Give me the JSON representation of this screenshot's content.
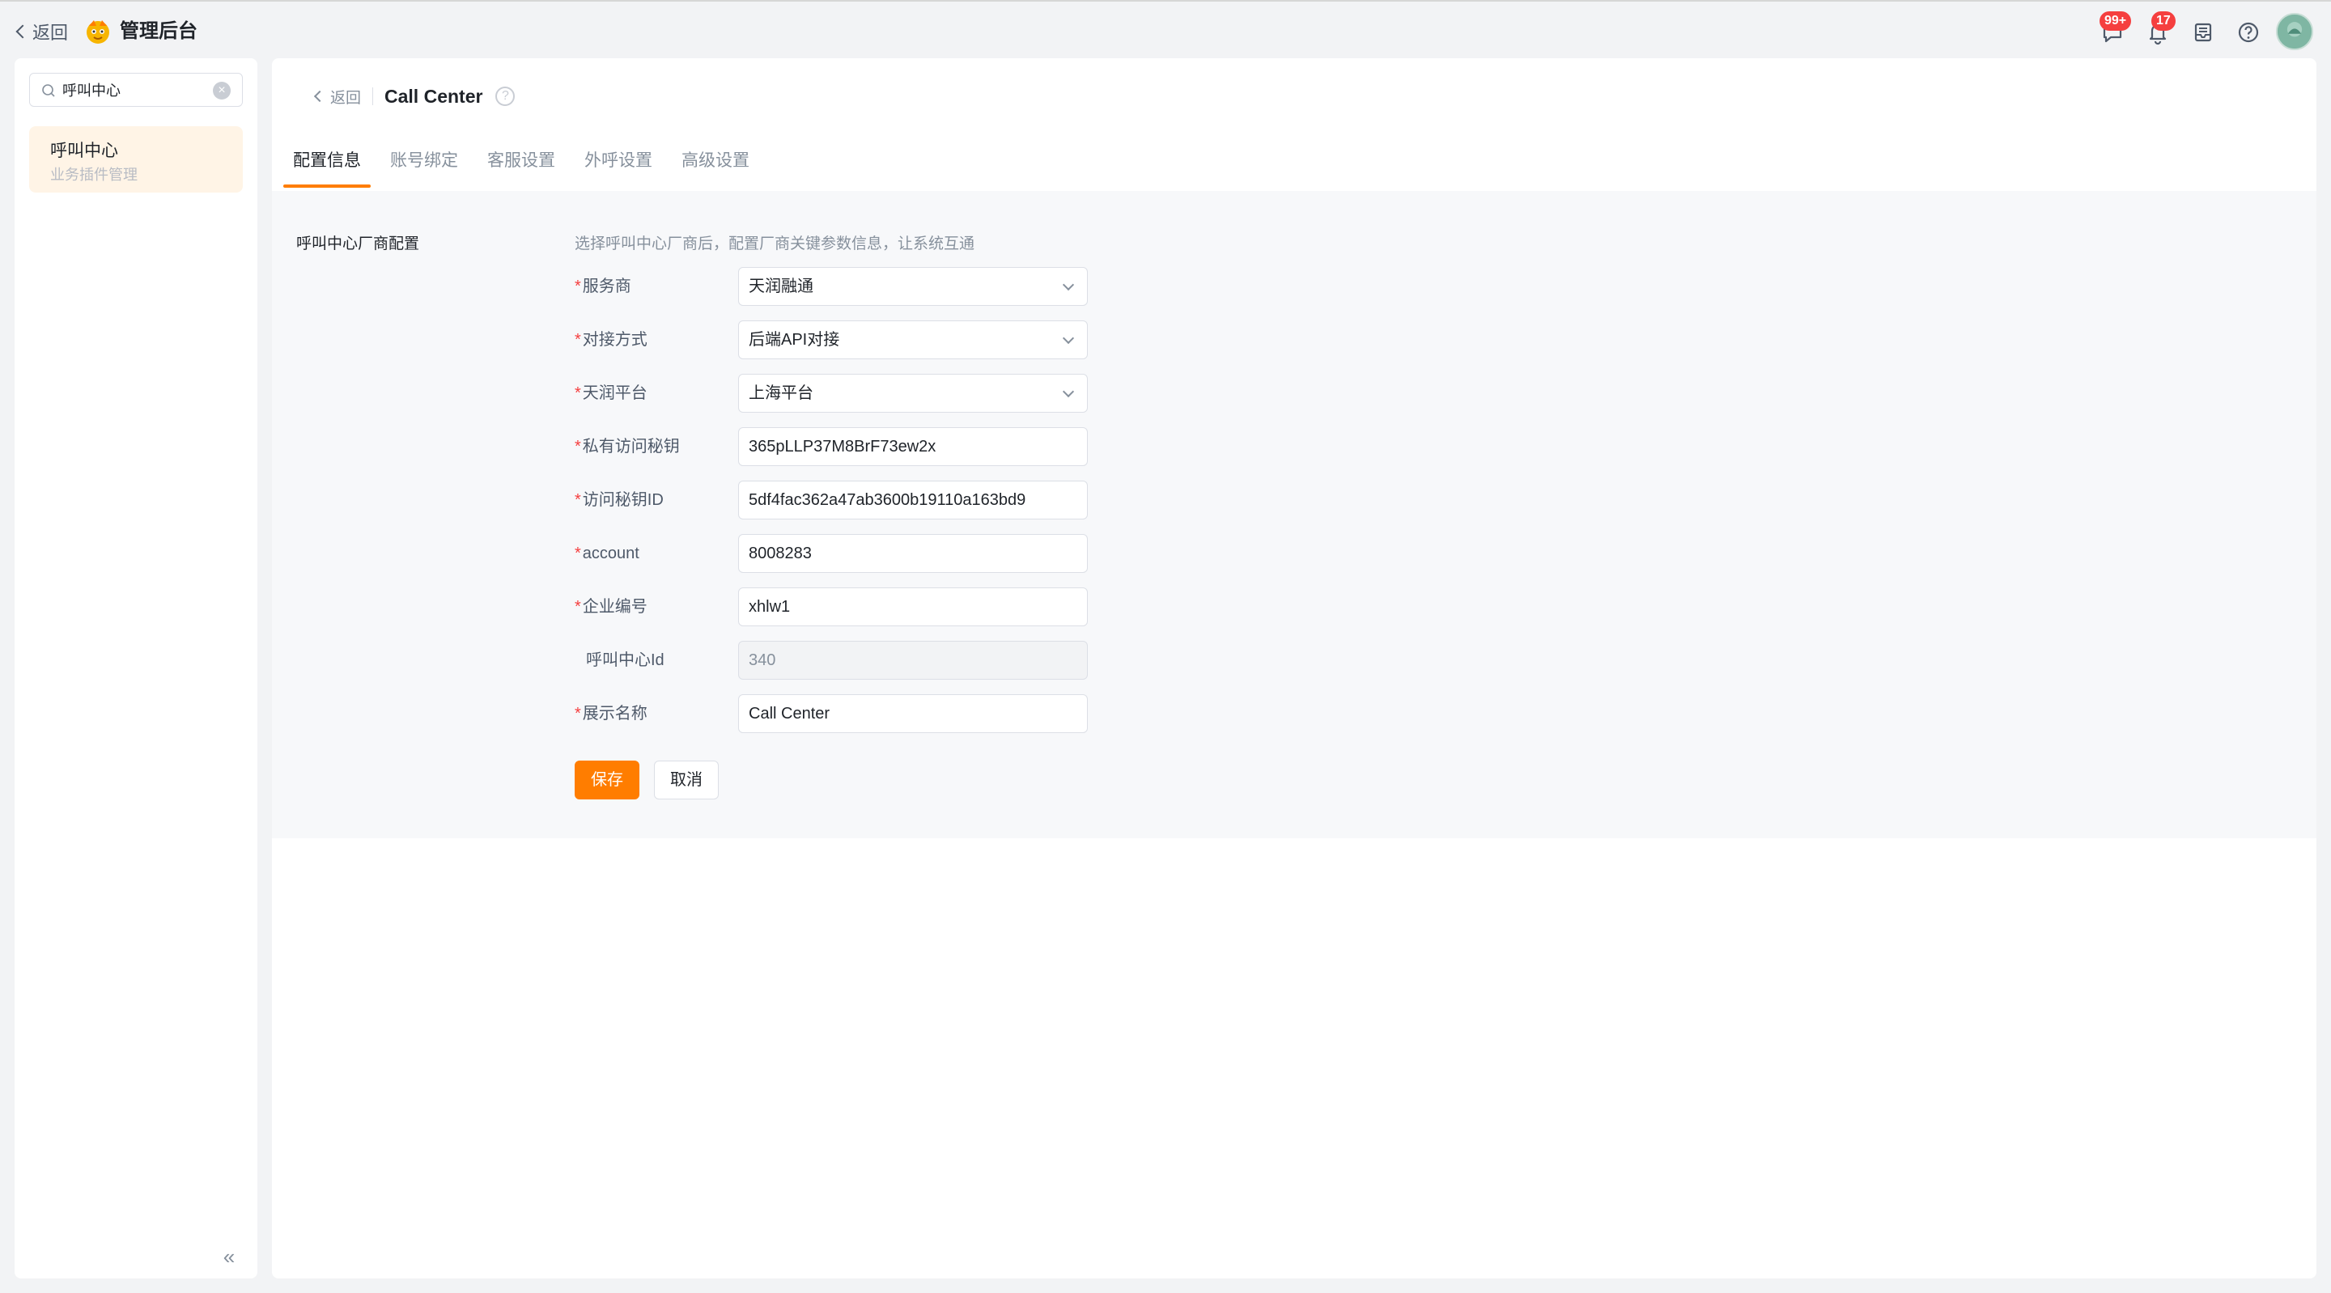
{
  "topbar": {
    "back_label": "返回",
    "app_title": "管理后台",
    "messages_badge": "99+",
    "notifications_badge": "17",
    "icons": [
      "chat-icon",
      "bell-icon",
      "inbox-icon",
      "help-icon"
    ]
  },
  "sidebar": {
    "search_value": "呼叫中心",
    "clear_label": "×",
    "items": [
      {
        "title": "呼叫中心",
        "subtitle": "业务插件管理"
      }
    ],
    "collapse_label": "«"
  },
  "main": {
    "breadcrumb": {
      "back_label": "返回",
      "title": "Call Center",
      "help": "?"
    },
    "tabs": [
      {
        "label": "配置信息",
        "active": true
      },
      {
        "label": "账号绑定",
        "active": false
      },
      {
        "label": "客服设置",
        "active": false
      },
      {
        "label": "外呼设置",
        "active": false
      },
      {
        "label": "高级设置",
        "active": false
      }
    ],
    "section": {
      "label": "呼叫中心厂商配置",
      "hint": "选择呼叫中心厂商后，配置厂商关键参数信息，让系统互通"
    },
    "form": {
      "provider": {
        "label": "服务商",
        "value": "天润融通"
      },
      "mode": {
        "label": "对接方式",
        "value": "后端API对接"
      },
      "platform": {
        "label": "天润平台",
        "value": "上海平台"
      },
      "secret": {
        "label": "私有访问秘钥",
        "value": "365pLLP37M8BrF73ew2x"
      },
      "key_id": {
        "label": "访问秘钥ID",
        "value": "5df4fac362a47ab3600b19110a163bd9"
      },
      "account": {
        "label": "account",
        "value": "8008283"
      },
      "enterprise": {
        "label": "企业编号",
        "value": "xhlw1"
      },
      "center_id": {
        "label": "呼叫中心Id",
        "value": "340"
      },
      "display_name": {
        "label": "展示名称",
        "value": "Call Center"
      },
      "required_mark": "*"
    },
    "buttons": {
      "save": "保存",
      "cancel": "取消"
    }
  },
  "colors": {
    "accent": "#ff7d00",
    "required": "#f53f3f",
    "badge": "#f53f3f"
  }
}
